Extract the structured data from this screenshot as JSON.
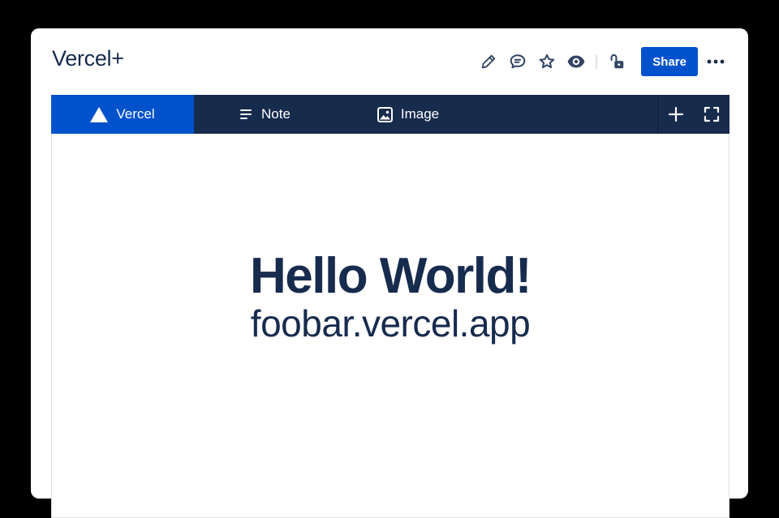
{
  "page": {
    "title": "Vercel+"
  },
  "toolbar": {
    "icons": [
      "pencil-icon",
      "comment-icon",
      "star-icon",
      "eye-icon",
      "unlock-icon"
    ],
    "share_label": "Share",
    "more_icon": "more-icon"
  },
  "embed": {
    "tabs": [
      {
        "label": "Vercel",
        "icon": "triangle-icon",
        "active": true
      },
      {
        "label": "Note",
        "icon": "lines-icon",
        "active": false
      },
      {
        "label": "Image",
        "icon": "image-icon",
        "active": false
      }
    ],
    "actions": [
      "plus-icon",
      "fullscreen-icon"
    ]
  },
  "preview": {
    "heading": "Hello World!",
    "url": "foobar.vercel.app"
  },
  "colors": {
    "accent": "#0052cc",
    "navy": "#172b4d",
    "background": "#000000"
  }
}
